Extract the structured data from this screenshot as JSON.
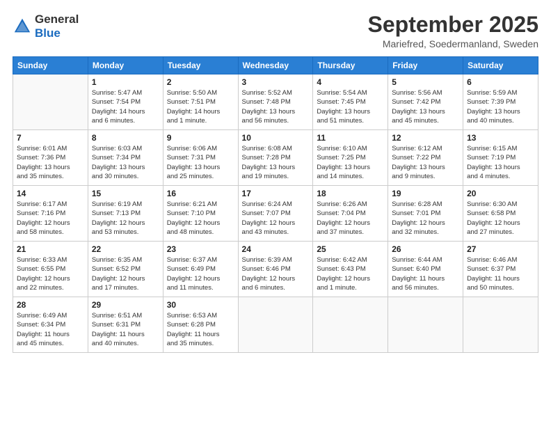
{
  "header": {
    "logo_general": "General",
    "logo_blue": "Blue",
    "month": "September 2025",
    "location": "Mariefred, Soedermanland, Sweden"
  },
  "weekdays": [
    "Sunday",
    "Monday",
    "Tuesday",
    "Wednesday",
    "Thursday",
    "Friday",
    "Saturday"
  ],
  "weeks": [
    [
      {
        "day": "",
        "info": ""
      },
      {
        "day": "1",
        "info": "Sunrise: 5:47 AM\nSunset: 7:54 PM\nDaylight: 14 hours\nand 6 minutes."
      },
      {
        "day": "2",
        "info": "Sunrise: 5:50 AM\nSunset: 7:51 PM\nDaylight: 14 hours\nand 1 minute."
      },
      {
        "day": "3",
        "info": "Sunrise: 5:52 AM\nSunset: 7:48 PM\nDaylight: 13 hours\nand 56 minutes."
      },
      {
        "day": "4",
        "info": "Sunrise: 5:54 AM\nSunset: 7:45 PM\nDaylight: 13 hours\nand 51 minutes."
      },
      {
        "day": "5",
        "info": "Sunrise: 5:56 AM\nSunset: 7:42 PM\nDaylight: 13 hours\nand 45 minutes."
      },
      {
        "day": "6",
        "info": "Sunrise: 5:59 AM\nSunset: 7:39 PM\nDaylight: 13 hours\nand 40 minutes."
      }
    ],
    [
      {
        "day": "7",
        "info": "Sunrise: 6:01 AM\nSunset: 7:36 PM\nDaylight: 13 hours\nand 35 minutes."
      },
      {
        "day": "8",
        "info": "Sunrise: 6:03 AM\nSunset: 7:34 PM\nDaylight: 13 hours\nand 30 minutes."
      },
      {
        "day": "9",
        "info": "Sunrise: 6:06 AM\nSunset: 7:31 PM\nDaylight: 13 hours\nand 25 minutes."
      },
      {
        "day": "10",
        "info": "Sunrise: 6:08 AM\nSunset: 7:28 PM\nDaylight: 13 hours\nand 19 minutes."
      },
      {
        "day": "11",
        "info": "Sunrise: 6:10 AM\nSunset: 7:25 PM\nDaylight: 13 hours\nand 14 minutes."
      },
      {
        "day": "12",
        "info": "Sunrise: 6:12 AM\nSunset: 7:22 PM\nDaylight: 13 hours\nand 9 minutes."
      },
      {
        "day": "13",
        "info": "Sunrise: 6:15 AM\nSunset: 7:19 PM\nDaylight: 13 hours\nand 4 minutes."
      }
    ],
    [
      {
        "day": "14",
        "info": "Sunrise: 6:17 AM\nSunset: 7:16 PM\nDaylight: 12 hours\nand 58 minutes."
      },
      {
        "day": "15",
        "info": "Sunrise: 6:19 AM\nSunset: 7:13 PM\nDaylight: 12 hours\nand 53 minutes."
      },
      {
        "day": "16",
        "info": "Sunrise: 6:21 AM\nSunset: 7:10 PM\nDaylight: 12 hours\nand 48 minutes."
      },
      {
        "day": "17",
        "info": "Sunrise: 6:24 AM\nSunset: 7:07 PM\nDaylight: 12 hours\nand 43 minutes."
      },
      {
        "day": "18",
        "info": "Sunrise: 6:26 AM\nSunset: 7:04 PM\nDaylight: 12 hours\nand 37 minutes."
      },
      {
        "day": "19",
        "info": "Sunrise: 6:28 AM\nSunset: 7:01 PM\nDaylight: 12 hours\nand 32 minutes."
      },
      {
        "day": "20",
        "info": "Sunrise: 6:30 AM\nSunset: 6:58 PM\nDaylight: 12 hours\nand 27 minutes."
      }
    ],
    [
      {
        "day": "21",
        "info": "Sunrise: 6:33 AM\nSunset: 6:55 PM\nDaylight: 12 hours\nand 22 minutes."
      },
      {
        "day": "22",
        "info": "Sunrise: 6:35 AM\nSunset: 6:52 PM\nDaylight: 12 hours\nand 17 minutes."
      },
      {
        "day": "23",
        "info": "Sunrise: 6:37 AM\nSunset: 6:49 PM\nDaylight: 12 hours\nand 11 minutes."
      },
      {
        "day": "24",
        "info": "Sunrise: 6:39 AM\nSunset: 6:46 PM\nDaylight: 12 hours\nand 6 minutes."
      },
      {
        "day": "25",
        "info": "Sunrise: 6:42 AM\nSunset: 6:43 PM\nDaylight: 12 hours\nand 1 minute."
      },
      {
        "day": "26",
        "info": "Sunrise: 6:44 AM\nSunset: 6:40 PM\nDaylight: 11 hours\nand 56 minutes."
      },
      {
        "day": "27",
        "info": "Sunrise: 6:46 AM\nSunset: 6:37 PM\nDaylight: 11 hours\nand 50 minutes."
      }
    ],
    [
      {
        "day": "28",
        "info": "Sunrise: 6:49 AM\nSunset: 6:34 PM\nDaylight: 11 hours\nand 45 minutes."
      },
      {
        "day": "29",
        "info": "Sunrise: 6:51 AM\nSunset: 6:31 PM\nDaylight: 11 hours\nand 40 minutes."
      },
      {
        "day": "30",
        "info": "Sunrise: 6:53 AM\nSunset: 6:28 PM\nDaylight: 11 hours\nand 35 minutes."
      },
      {
        "day": "",
        "info": ""
      },
      {
        "day": "",
        "info": ""
      },
      {
        "day": "",
        "info": ""
      },
      {
        "day": "",
        "info": ""
      }
    ]
  ]
}
